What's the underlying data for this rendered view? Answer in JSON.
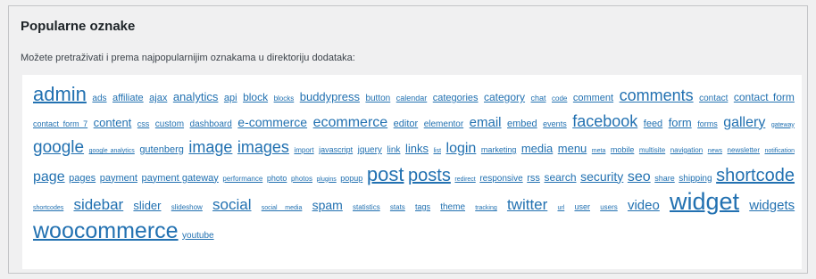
{
  "section": {
    "title": "Popularne oznake",
    "description": "Možete pretraživati i prema najpopularnijim oznakama u direktoriju dodataka:"
  },
  "tags": [
    {
      "label": "admin",
      "size": 22
    },
    {
      "label": "ads",
      "size": 10
    },
    {
      "label": "affiliate",
      "size": 11
    },
    {
      "label": "ajax",
      "size": 11
    },
    {
      "label": "analytics",
      "size": 13
    },
    {
      "label": "api",
      "size": 11
    },
    {
      "label": "block",
      "size": 12
    },
    {
      "label": "blocks",
      "size": 8
    },
    {
      "label": "buddypress",
      "size": 13
    },
    {
      "label": "button",
      "size": 10
    },
    {
      "label": "calendar",
      "size": 9
    },
    {
      "label": "categories",
      "size": 11
    },
    {
      "label": "category",
      "size": 12
    },
    {
      "label": "chat",
      "size": 9
    },
    {
      "label": "code",
      "size": 8
    },
    {
      "label": "comment",
      "size": 11
    },
    {
      "label": "comments",
      "size": 18
    },
    {
      "label": "contact",
      "size": 10
    },
    {
      "label": "contact form",
      "size": 12
    },
    {
      "label": "contact form 7",
      "size": 9
    },
    {
      "label": "content",
      "size": 13
    },
    {
      "label": "css",
      "size": 9
    },
    {
      "label": "custom",
      "size": 10
    },
    {
      "label": "dashboard",
      "size": 10
    },
    {
      "label": "e-commerce",
      "size": 14
    },
    {
      "label": "ecommerce",
      "size": 16
    },
    {
      "label": "editor",
      "size": 11
    },
    {
      "label": "elementor",
      "size": 10
    },
    {
      "label": "email",
      "size": 15
    },
    {
      "label": "embed",
      "size": 11
    },
    {
      "label": "events",
      "size": 9
    },
    {
      "label": "facebook",
      "size": 18
    },
    {
      "label": "feed",
      "size": 11
    },
    {
      "label": "form",
      "size": 13
    },
    {
      "label": "forms",
      "size": 9
    },
    {
      "label": "gallery",
      "size": 16
    },
    {
      "label": "gateway",
      "size": 7
    },
    {
      "label": "google",
      "size": 19
    },
    {
      "label": "google analytics",
      "size": 7
    },
    {
      "label": "gutenberg",
      "size": 11
    },
    {
      "label": "image",
      "size": 18
    },
    {
      "label": "images",
      "size": 18
    },
    {
      "label": "import",
      "size": 8
    },
    {
      "label": "javascript",
      "size": 9
    },
    {
      "label": "jquery",
      "size": 10
    },
    {
      "label": "link",
      "size": 10
    },
    {
      "label": "links",
      "size": 13
    },
    {
      "label": "list",
      "size": 7
    },
    {
      "label": "login",
      "size": 16
    },
    {
      "label": "marketing",
      "size": 9
    },
    {
      "label": "media",
      "size": 13
    },
    {
      "label": "menu",
      "size": 13
    },
    {
      "label": "meta",
      "size": 7
    },
    {
      "label": "mobile",
      "size": 9
    },
    {
      "label": "multisite",
      "size": 8
    },
    {
      "label": "navigation",
      "size": 8
    },
    {
      "label": "news",
      "size": 7
    },
    {
      "label": "newsletter",
      "size": 8
    },
    {
      "label": "notification",
      "size": 7
    },
    {
      "label": "page",
      "size": 16
    },
    {
      "label": "pages",
      "size": 11
    },
    {
      "label": "payment",
      "size": 11
    },
    {
      "label": "payment gateway",
      "size": 11
    },
    {
      "label": "performance",
      "size": 8
    },
    {
      "label": "photo",
      "size": 9
    },
    {
      "label": "photos",
      "size": 8
    },
    {
      "label": "plugins",
      "size": 7
    },
    {
      "label": "popup",
      "size": 9
    },
    {
      "label": "post",
      "size": 22
    },
    {
      "label": "posts",
      "size": 20
    },
    {
      "label": "redirect",
      "size": 7
    },
    {
      "label": "responsive",
      "size": 10
    },
    {
      "label": "rss",
      "size": 11
    },
    {
      "label": "search",
      "size": 12
    },
    {
      "label": "security",
      "size": 14
    },
    {
      "label": "seo",
      "size": 16
    },
    {
      "label": "share",
      "size": 9
    },
    {
      "label": "shipping",
      "size": 10
    },
    {
      "label": "shortcode",
      "size": 20
    },
    {
      "label": "shortcodes",
      "size": 7
    },
    {
      "label": "sidebar",
      "size": 17
    },
    {
      "label": "slider",
      "size": 13
    },
    {
      "label": "slideshow",
      "size": 8
    },
    {
      "label": "social",
      "size": 17
    },
    {
      "label": "social media",
      "size": 7
    },
    {
      "label": "spam",
      "size": 14
    },
    {
      "label": "statistics",
      "size": 8
    },
    {
      "label": "stats",
      "size": 8
    },
    {
      "label": "tags",
      "size": 9
    },
    {
      "label": "theme",
      "size": 10
    },
    {
      "label": "tracking",
      "size": 7
    },
    {
      "label": "twitter",
      "size": 17
    },
    {
      "label": "url",
      "size": 7
    },
    {
      "label": "user",
      "size": 9
    },
    {
      "label": "users",
      "size": 8
    },
    {
      "label": "video",
      "size": 15
    },
    {
      "label": "widget",
      "size": 27
    },
    {
      "label": "widgets",
      "size": 15
    },
    {
      "label": "woocommerce",
      "size": 25
    },
    {
      "label": "youtube",
      "size": 10
    }
  ],
  "colors": {
    "background": "#f0f0f1",
    "cloud_background": "#ffffff",
    "link": "#2271b1",
    "title": "#1d2327"
  }
}
